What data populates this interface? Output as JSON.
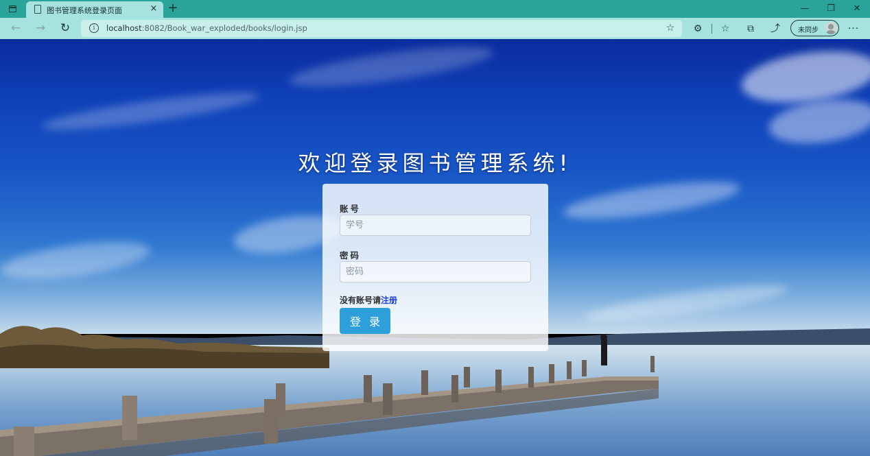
{
  "browser": {
    "tab_title": "图书管理系统登录页面",
    "tab_close_glyph": "×",
    "new_tab_glyph": "+",
    "url_host": "localhost",
    "url_rest": ":8082/Book_war_exploded/books/login.jsp",
    "profile_label": "未同步",
    "window_controls": {
      "minimize": "—",
      "maximize": "❐",
      "close": "✕"
    },
    "nav": {
      "back": "←",
      "forward": "→",
      "reload": "↻"
    },
    "toolbar_icons": {
      "favorite_add": "☆",
      "extensions": "⚙",
      "favorites": "☆",
      "collections": "⧉",
      "share": "⤴",
      "more": "···"
    },
    "info_glyph": "i",
    "colors": {
      "tabbar": "#2aa39b",
      "toolbar": "#a6e3de",
      "addressbar": "#c9efeb"
    }
  },
  "page": {
    "welcome_title": "欢迎登录图书管理系统!",
    "form": {
      "account_label": "账号",
      "account_placeholder": "学号",
      "password_label": "密码",
      "password_placeholder": "密码",
      "register_prompt": "没有账号请",
      "register_link": "注册",
      "login_button": "登录"
    },
    "colors": {
      "button": "#2d9fdb",
      "link": "#1a3ee0"
    }
  }
}
